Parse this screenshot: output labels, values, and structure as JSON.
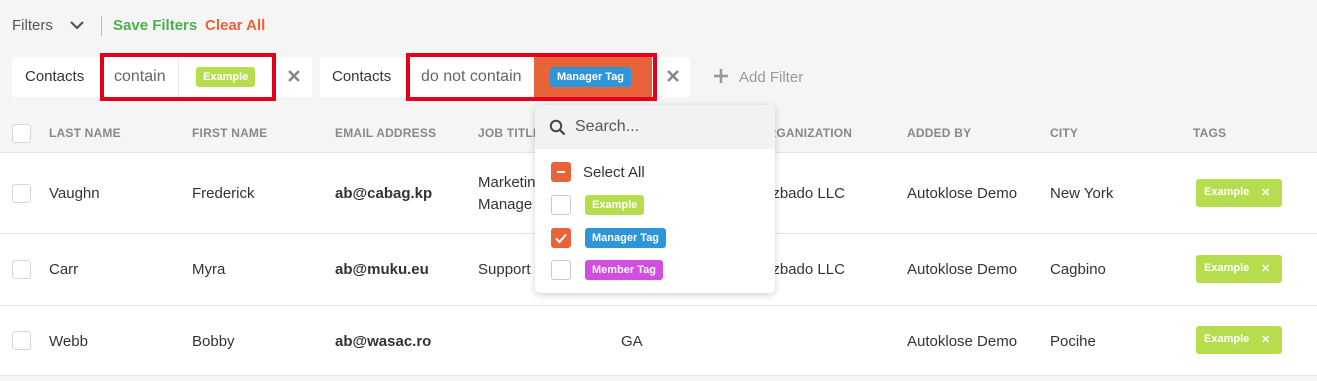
{
  "topbar": {
    "filters_label": "Filters",
    "save_filters": "Save Filters",
    "clear_all": "Clear All"
  },
  "filters": [
    {
      "field": "Contacts",
      "operator": "contain",
      "value_tag": "Example",
      "value_tag_color": "#b6dd4e"
    },
    {
      "field": "Contacts",
      "operator": "do not contain",
      "value_tag": "Manager Tag",
      "value_tag_color": "#2e95d8"
    }
  ],
  "add_filter": "Add Filter",
  "dropdown": {
    "search_placeholder": "Search...",
    "select_all": "Select All",
    "options": [
      {
        "label": "Example",
        "color": "#b6dd4e",
        "checked": false
      },
      {
        "label": "Manager Tag",
        "color": "#2e95d8",
        "checked": true
      },
      {
        "label": "Member Tag",
        "color": "#d24de0",
        "checked": false
      }
    ]
  },
  "table": {
    "columns": [
      "LAST NAME",
      "FIRST NAME",
      "EMAIL ADDRESS",
      "JOB TITLE",
      "ORGANIZATION",
      "ADDED BY",
      "CITY",
      "TAGS"
    ],
    "rows": [
      {
        "last": "Vaughn",
        "first": "Frederick",
        "email": "ab@cabag.kp",
        "job_line1": "Marketin",
        "job_line2": "Manage",
        "state": "",
        "org": "ezbado LLC",
        "added_by": "Autoklose Demo",
        "city": "New York",
        "tag": "Example"
      },
      {
        "last": "Carr",
        "first": "Myra",
        "email": "ab@muku.eu",
        "job_line1": "Support",
        "job_line2": "",
        "state": "",
        "org": "ezbado LLC",
        "added_by": "Autoklose Demo",
        "city": "Cagbino",
        "tag": "Example"
      },
      {
        "last": "Webb",
        "first": "Bobby",
        "email": "ab@wasac.ro",
        "job_line1": "",
        "job_line2": "",
        "state": "GA",
        "org": "",
        "added_by": "Autoklose Demo",
        "city": "Pocihe",
        "tag": "Example"
      }
    ]
  },
  "colors": {
    "accent_orange": "#e8623a",
    "save_green": "#4caf50",
    "highlight_red": "#e4001b",
    "tag_green": "#b6dd4e"
  }
}
